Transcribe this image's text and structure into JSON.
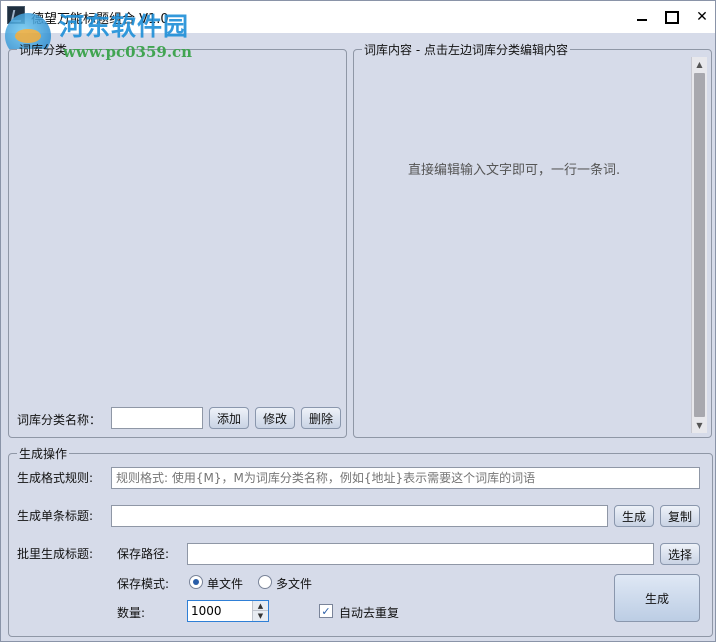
{
  "window": {
    "title": "德望万能标题组合 V1.0",
    "watermark_name": "河东软件园",
    "watermark_url": "www.pc0359.cn"
  },
  "category_group": {
    "legend": "词库分类",
    "name_label": "词库分类名称：",
    "name_value": "",
    "add_label": "添加",
    "edit_label": "修改",
    "delete_label": "删除"
  },
  "content_group": {
    "legend": "词库内容 - 点击左边词库分类编辑内容",
    "hint": "直接编辑输入文字即可，一行一条词."
  },
  "generate_group": {
    "legend": "生成操作",
    "rule_label": "生成格式规则:",
    "rule_placeholder": "规则格式: 使用{M}，M为词库分类名称，例如{地址}表示需要这个词库的词语",
    "single_label": "生成单条标题:",
    "single_value": "",
    "generate_label": "生成",
    "copy_label": "复制",
    "batch_label": "批里生成标题:",
    "save_path_label": "保存路径:",
    "save_path_value": "",
    "browse_label": "选择",
    "save_mode_label": "保存模式:",
    "mode_single": "单文件",
    "mode_multi": "多文件",
    "selected_mode": "单文件",
    "quantity_label": "数量:",
    "quantity_value": "1000",
    "dedupe_label": "自动去重复",
    "dedupe_checked": true,
    "big_generate_label": "生成"
  }
}
